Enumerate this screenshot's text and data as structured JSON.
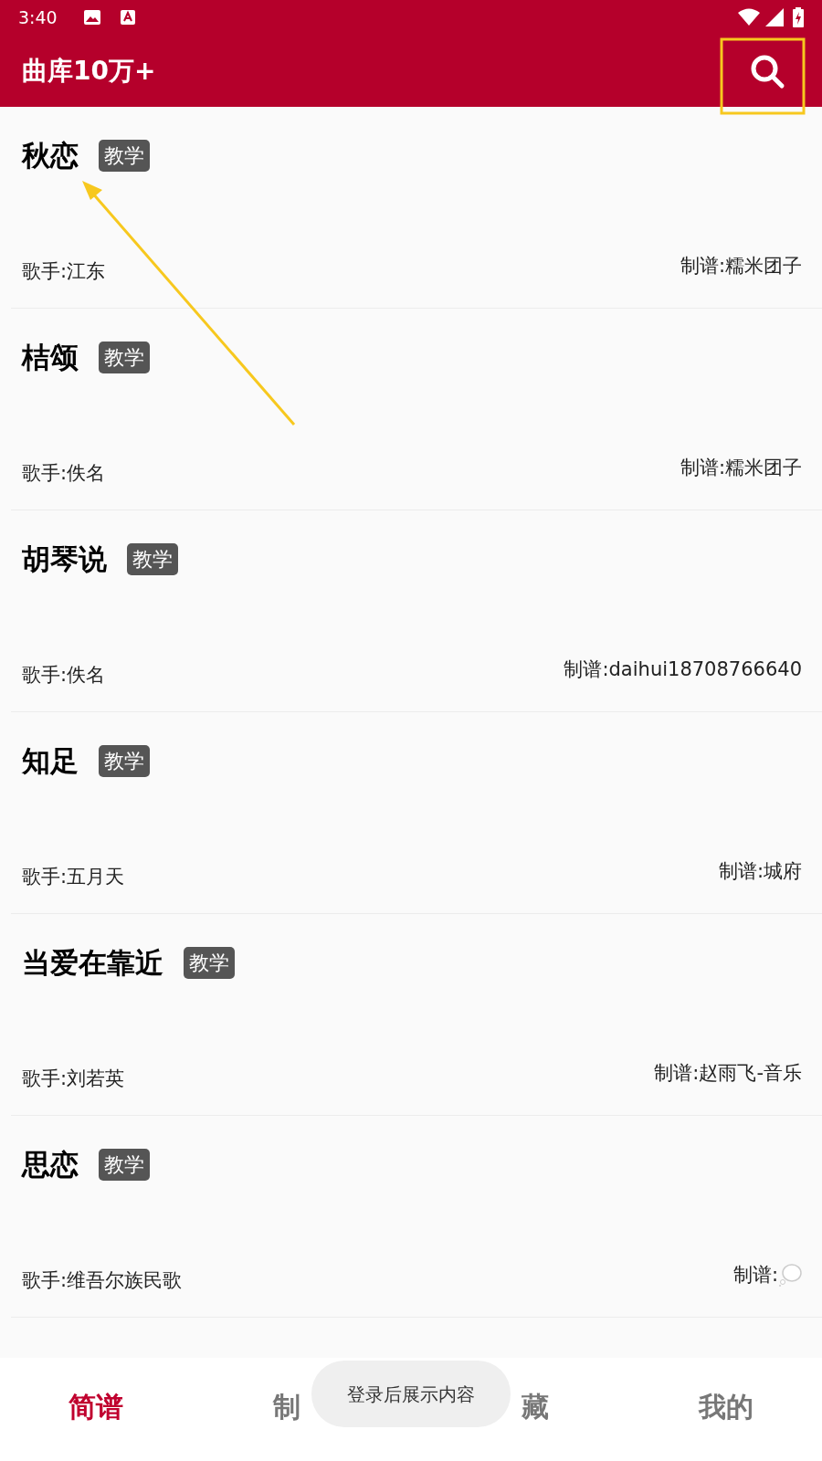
{
  "status_bar": {
    "time": "3:40"
  },
  "app_bar": {
    "title": "曲库10万+"
  },
  "songs": [
    {
      "title": "秋恋",
      "tag": "教学",
      "singer": "歌手:江东",
      "maker": "制谱:糯米团子"
    },
    {
      "title": "桔颂",
      "tag": "教学",
      "singer": "歌手:佚名",
      "maker": "制谱:糯米团子"
    },
    {
      "title": "胡琴说",
      "tag": "教学",
      "singer": "歌手:佚名",
      "maker": "制谱:daihui18708766640"
    },
    {
      "title": "知足",
      "tag": "教学",
      "singer": "歌手:五月天",
      "maker": "制谱:城府"
    },
    {
      "title": "当爱在靠近",
      "tag": "教学",
      "singer": "歌手:刘若英",
      "maker": "制谱:赵雨飞-音乐"
    },
    {
      "title": "思恋",
      "tag": "教学",
      "singer": "歌手:维吾尔族民歌",
      "maker": "制谱:",
      "kind": "with-icon"
    }
  ],
  "bottom_nav": [
    {
      "label": "简谱",
      "selected": true
    },
    {
      "label": "制",
      "selected": false
    },
    {
      "label": "藏",
      "selected": false
    },
    {
      "label": "我的",
      "selected": false
    }
  ],
  "toast": "登录后展示内容"
}
